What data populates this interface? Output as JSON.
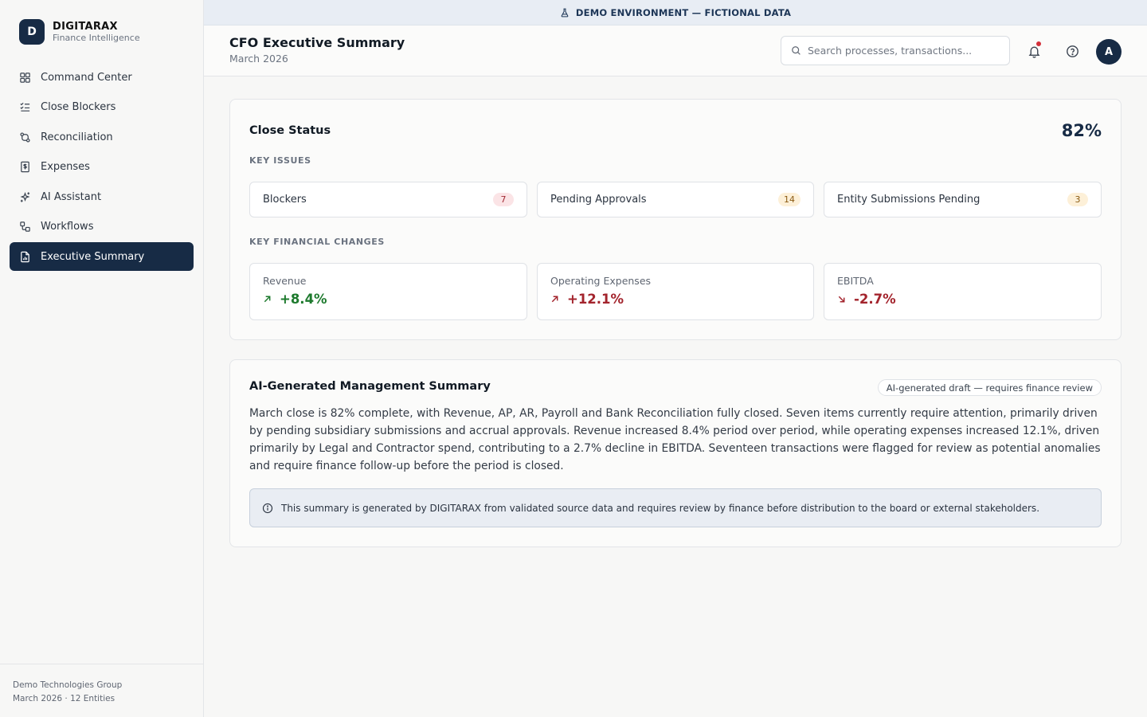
{
  "brand": {
    "logo_letter": "D",
    "name": "DIGITARAX",
    "tagline": "Finance Intelligence"
  },
  "sidebar": {
    "items": [
      {
        "label": "Command Center",
        "icon": "grid-icon"
      },
      {
        "label": "Close Blockers",
        "icon": "list-check-icon"
      },
      {
        "label": "Reconciliation",
        "icon": "git-compare-icon"
      },
      {
        "label": "Expenses",
        "icon": "receipt-dollar-icon"
      },
      {
        "label": "AI Assistant",
        "icon": "sparkles-icon"
      },
      {
        "label": "Workflows",
        "icon": "workflow-icon"
      },
      {
        "label": "Executive Summary",
        "icon": "file-chart-icon",
        "active": true
      }
    ],
    "footer": {
      "org": "Demo Technologies Group",
      "period": "March 2026 · 12 Entities"
    }
  },
  "banner": {
    "text": "DEMO ENVIRONMENT — FICTIONAL DATA",
    "icon": "flask-icon"
  },
  "header": {
    "title": "CFO Executive Summary",
    "subtitle": "March 2026",
    "search_placeholder": "Search processes, transactions...",
    "avatar_letter": "A",
    "notification_dot": true
  },
  "close_status": {
    "title": "Close Status",
    "percent": "82%",
    "key_issues_label": "KEY ISSUES",
    "issues": [
      {
        "label": "Blockers",
        "count": "7",
        "tone": "red"
      },
      {
        "label": "Pending Approvals",
        "count": "14",
        "tone": "amber"
      },
      {
        "label": "Entity Submissions Pending",
        "count": "3",
        "tone": "amber"
      }
    ],
    "changes_label": "KEY FINANCIAL CHANGES",
    "changes": [
      {
        "label": "Revenue",
        "value": "+8.4%",
        "direction": "up",
        "tone": "green"
      },
      {
        "label": "Operating Expenses",
        "value": "+12.1%",
        "direction": "up",
        "tone": "red"
      },
      {
        "label": "EBITDA",
        "value": "-2.7%",
        "direction": "down",
        "tone": "red"
      }
    ]
  },
  "ai_summary": {
    "title": "AI-Generated Management Summary",
    "tag": "AI-generated draft — requires finance review",
    "body": "March close is 82% complete, with Revenue, AP, AR, Payroll and Bank Reconciliation fully closed. Seven items currently require attention, primarily driven by pending subsidiary submissions and accrual approvals. Revenue increased 8.4% period over period, while operating expenses increased 12.1%, driven primarily by Legal and Contractor spend, contributing to a 2.7% decline in EBITDA. Seventeen transactions were flagged for review as potential anomalies and require finance follow-up before the period is closed.",
    "note": "This summary is generated by DIGITARAX from validated source data and requires review by finance before distribution to the board or external stakeholders."
  },
  "colors": {
    "navy": "#172b45",
    "positive": "#1e7a2e",
    "negative": "#a3242d",
    "alert_dot": "#d32f3a"
  }
}
